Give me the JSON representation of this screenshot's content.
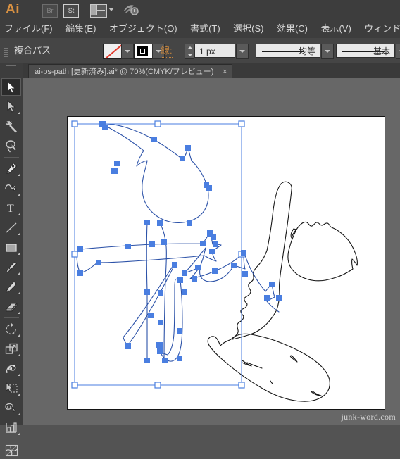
{
  "app": {
    "name": "Ai",
    "logo_color": "#d89142",
    "bridge_label": "Br",
    "stock_label": "St"
  },
  "menubar": {
    "items": [
      {
        "label": "ファイル(F)"
      },
      {
        "label": "編集(E)"
      },
      {
        "label": "オブジェクト(O)"
      },
      {
        "label": "書式(T)"
      },
      {
        "label": "選択(S)"
      },
      {
        "label": "効果(C)"
      },
      {
        "label": "表示(V)"
      },
      {
        "label": "ウィンドウ("
      }
    ]
  },
  "control_bar": {
    "object_type": "複合パス",
    "fill_label": "なし",
    "stroke_label": "線:",
    "stroke_weight": "1 px",
    "profile_label": "均等",
    "brush_label": "基本"
  },
  "tabs": [
    {
      "title": "ai-ps-path [更新済み].ai* @ 70%(CMYK/プレビュー)",
      "close": "×",
      "active": true
    }
  ],
  "toolbox": {
    "tools": [
      {
        "name": "selection-tool",
        "active": true
      },
      {
        "name": "direct-selection-tool",
        "active": false
      },
      {
        "name": "magic-wand-tool",
        "active": false
      },
      {
        "name": "lasso-tool",
        "active": false
      },
      {
        "name": "pen-tool",
        "active": false
      },
      {
        "name": "curvature-tool",
        "active": false
      },
      {
        "name": "type-tool",
        "active": false
      },
      {
        "name": "line-segment-tool",
        "active": false
      },
      {
        "name": "rectangle-tool",
        "active": false
      },
      {
        "name": "paintbrush-tool",
        "active": false
      },
      {
        "name": "pencil-tool",
        "active": false
      },
      {
        "name": "eraser-tool",
        "active": false
      },
      {
        "name": "rotate-tool",
        "active": false
      },
      {
        "name": "scale-tool",
        "active": false
      },
      {
        "name": "width-tool",
        "active": false
      },
      {
        "name": "free-transform-tool",
        "active": false
      },
      {
        "name": "shape-builder-tool",
        "active": false
      },
      {
        "name": "graph-tool",
        "active": false
      },
      {
        "name": "mesh-tool",
        "active": false
      }
    ]
  },
  "canvas": {
    "zoom": "70%",
    "color_mode": "CMYK/プレビュー",
    "selection_color": "#4a7ee0",
    "path_stroke_color": "#111111",
    "artboard_background": "#ffffff",
    "workspace_background": "#676767"
  },
  "watermark": {
    "text": "junk-word.com"
  }
}
